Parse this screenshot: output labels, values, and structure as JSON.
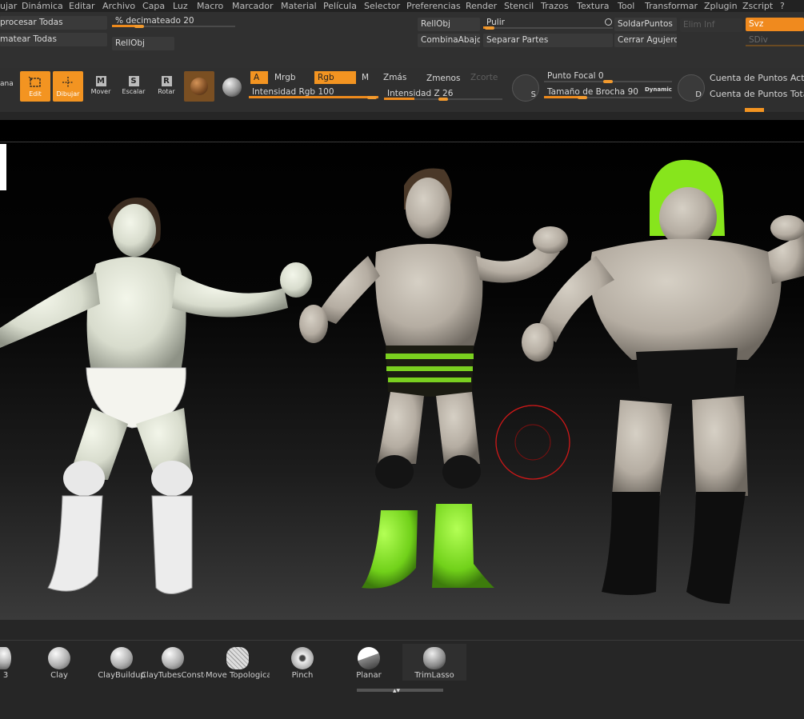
{
  "menu": [
    "ujar",
    "Dinámica",
    "Editar",
    "Archivo",
    "Capa",
    "Luz",
    "Macro",
    "Marcador",
    "Material",
    "Película",
    "Selector",
    "Preferencias",
    "Render",
    "Stencil",
    "Trazos",
    "Textura",
    "Tool",
    "Transformar",
    "Zplugin",
    "Zscript",
    "?"
  ],
  "palette": {
    "procesar_todas": "procesar Todas",
    "decimateado_label": "% decimateado",
    "decimateado_value": "20",
    "decimateado_level": 0.2,
    "matear_todas": "matear Todas",
    "rellobj_1": "RellObj",
    "rellobj_2": "RellObj",
    "pulir": "Pulir",
    "soldar_puntos": "SoldarPuntos",
    "elim_inf": "Elim Inf",
    "svz": "Svz",
    "combina_abajo": "CombinaAbajo",
    "separar_partes": "Separar Partes",
    "cerrar_agujeros": "Cerrar Agujeros",
    "sdiv": "SDiv"
  },
  "tools": {
    "ventana": "ana",
    "edit": "Edit",
    "dibujar": "Dibujar",
    "mover": "Mover",
    "escalar": "Escalar",
    "rotar": "Rotar",
    "mover_key": "M",
    "escalar_key": "S",
    "rotar_key": "R"
  },
  "color_modes": {
    "a": "A",
    "mrgb": "Mrgb",
    "rgb": "Rgb",
    "m": "M",
    "zmas": "Zmás",
    "zmenos": "Zmenos",
    "zcorte": "Zcorte"
  },
  "sliders": {
    "intensidad_rgb_label": "Intensidad Rgb",
    "intensidad_rgb_value": "100",
    "intensidad_rgb_level": 1.0,
    "intensidad_z_label": "Intensidad Z",
    "intensidad_z_value": "26",
    "intensidad_z_level": 0.26,
    "punto_focal_label": "Punto Focal",
    "punto_focal_value": "0",
    "punto_focal_level": 0.5,
    "tamano_label": "Tamaño de Brocha",
    "tamano_value": "90",
    "tamano_level": 0.3,
    "dynamic": "Dynamic"
  },
  "counts": {
    "activos": "Cuenta de Puntos Activos",
    "totales": "Cuenta de Puntos Totales",
    "s_key": "S",
    "d_key": "D"
  },
  "brushes": [
    "3",
    "Clay",
    "ClayBuildup",
    "ClayTubes",
    "Conste",
    "Move Topological",
    "Pinch",
    "Planar",
    "TrimLasso"
  ],
  "colors": {
    "accent": "#f39421",
    "background": "#303030",
    "hair_green": "#7fe21a",
    "boots_green": "#78d51a",
    "skin": "#c9c2b6",
    "figure_white": "#e4e8da"
  }
}
